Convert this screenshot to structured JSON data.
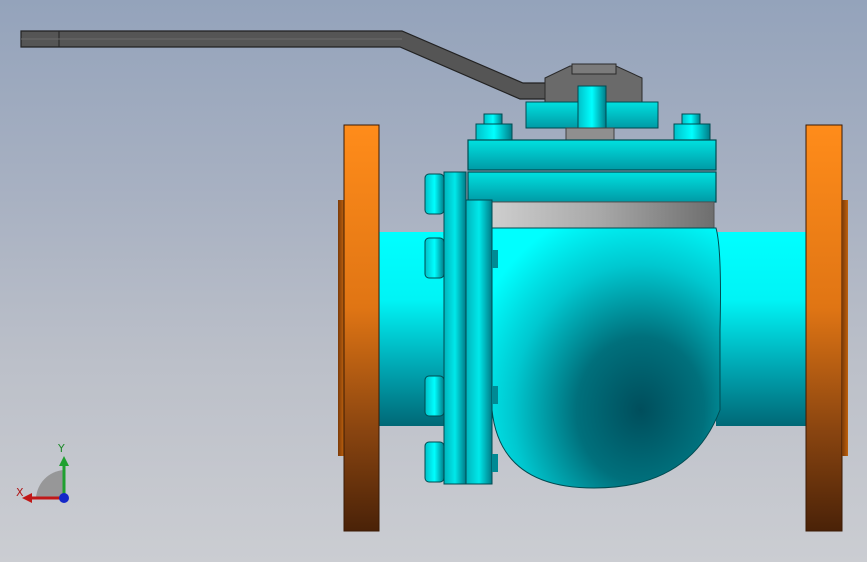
{
  "viewport": {
    "background_top": "#94a3bb",
    "background_bottom": "#cbcdd2"
  },
  "model": {
    "part_colors": {
      "handle": "#5a5a5a",
      "body": "#00ffff",
      "body_shade": "#005a66",
      "flange": "#ff8c1a",
      "flange_shade": "#5a2a08",
      "bonnet_band": "#9a9a9a"
    }
  },
  "triad": {
    "x_label": "X",
    "y_label": "Y",
    "x_color": "#c01818",
    "y_color": "#1fa030",
    "z_color": "#1428c8"
  }
}
